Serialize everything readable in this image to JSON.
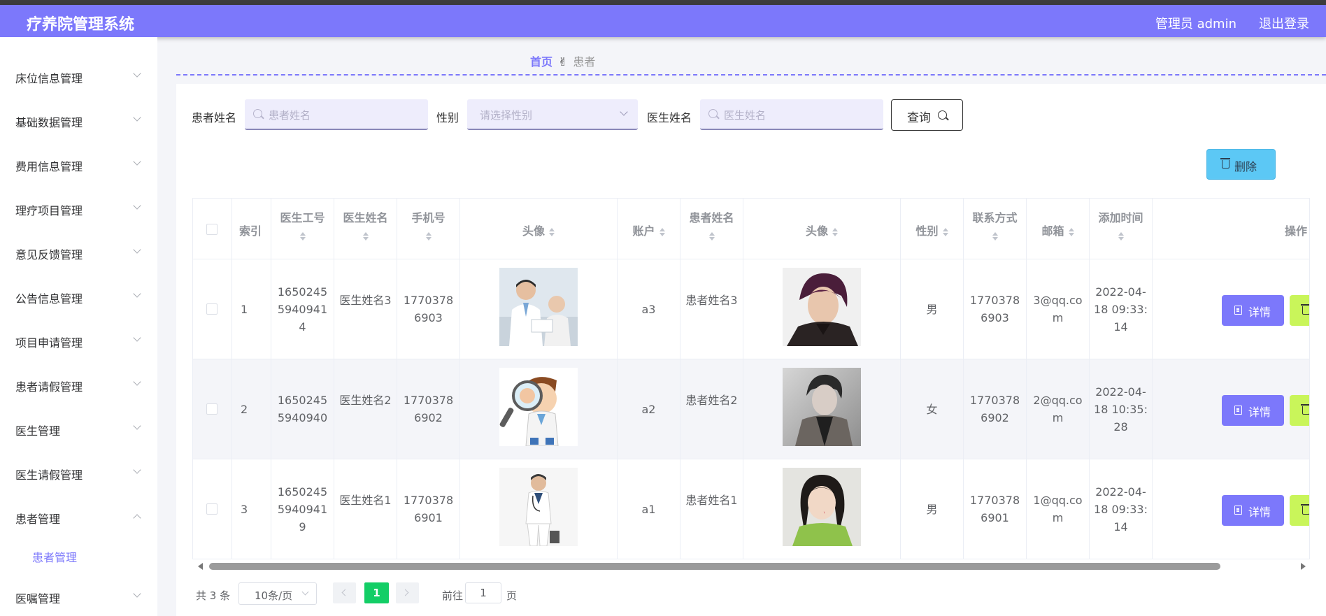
{
  "app": {
    "title": "疗养院管理系统",
    "user": "管理员 admin",
    "logout": "退出登录"
  },
  "sidebar": {
    "items": [
      {
        "label": "床位信息管理"
      },
      {
        "label": "基础数据管理"
      },
      {
        "label": "费用信息管理"
      },
      {
        "label": "理疗项目管理"
      },
      {
        "label": "意见反馈管理"
      },
      {
        "label": "公告信息管理"
      },
      {
        "label": "项目申请管理"
      },
      {
        "label": "患者请假管理"
      },
      {
        "label": "医生管理"
      },
      {
        "label": "医生请假管理"
      },
      {
        "label": "患者管理",
        "expanded": true
      },
      {
        "label": "医嘱管理"
      }
    ],
    "active_sub": "患者管理"
  },
  "breadcrumb": {
    "home": "首页",
    "current": "患者"
  },
  "filters": {
    "patient_name_label": "患者姓名",
    "patient_name_placeholder": "患者姓名",
    "gender_label": "性别",
    "gender_placeholder": "请选择性别",
    "doctor_name_label": "医生姓名",
    "doctor_name_placeholder": "医生姓名",
    "query_label": "查询"
  },
  "toolbar": {
    "delete_label": "删除"
  },
  "table": {
    "headers": {
      "index": "索引",
      "doctor_id": "医生工号",
      "doctor_name": "医生姓名",
      "phone": "手机号",
      "avatar": "头像",
      "account": "账户",
      "patient_name": "患者姓名",
      "patient_avatar": "头像",
      "gender": "性别",
      "contact": "联系方式",
      "email": "邮箱",
      "created": "添加时间",
      "actions": "操作"
    },
    "rows": [
      {
        "index": "1",
        "doctor_id": "16502455940941 4",
        "doctor_name": "医生姓名3",
        "phone": "17703786903",
        "account": "a3",
        "patient_name": "患者姓名3",
        "gender": "男",
        "contact": "17703786903",
        "email": "3@qq.com",
        "created": "2022-04-18 09:33:14"
      },
      {
        "index": "2",
        "doctor_id": "1650245 5940940",
        "doctor_name": "医生姓名2",
        "phone": "17703786902",
        "account": "a2",
        "patient_name": "患者姓名2",
        "gender": "女",
        "contact": "17703786902",
        "email": "2@qq.com",
        "created": "2022-04-18 10:35:28"
      },
      {
        "index": "3",
        "doctor_id": "16502455940941 9",
        "doctor_name": "医生姓名1",
        "phone": "17703786901",
        "account": "a1",
        "patient_name": "患者姓名1",
        "gender": "男",
        "contact": "17703786901",
        "email": "1@qq.com",
        "created": "2022-04-18 09:33:14"
      }
    ],
    "detail_label": "详情",
    "row_delete_label": "删"
  },
  "pagination": {
    "total": "共 3 条",
    "page_size": "10条/页",
    "current": "1",
    "goto": "前往",
    "goto_value": "1",
    "page_unit": "页"
  },
  "colors": {
    "accent": "#7c78fb",
    "delete": "#5cc8f5",
    "row_delete": "#c9f55a",
    "page_active": "#13ce66"
  }
}
